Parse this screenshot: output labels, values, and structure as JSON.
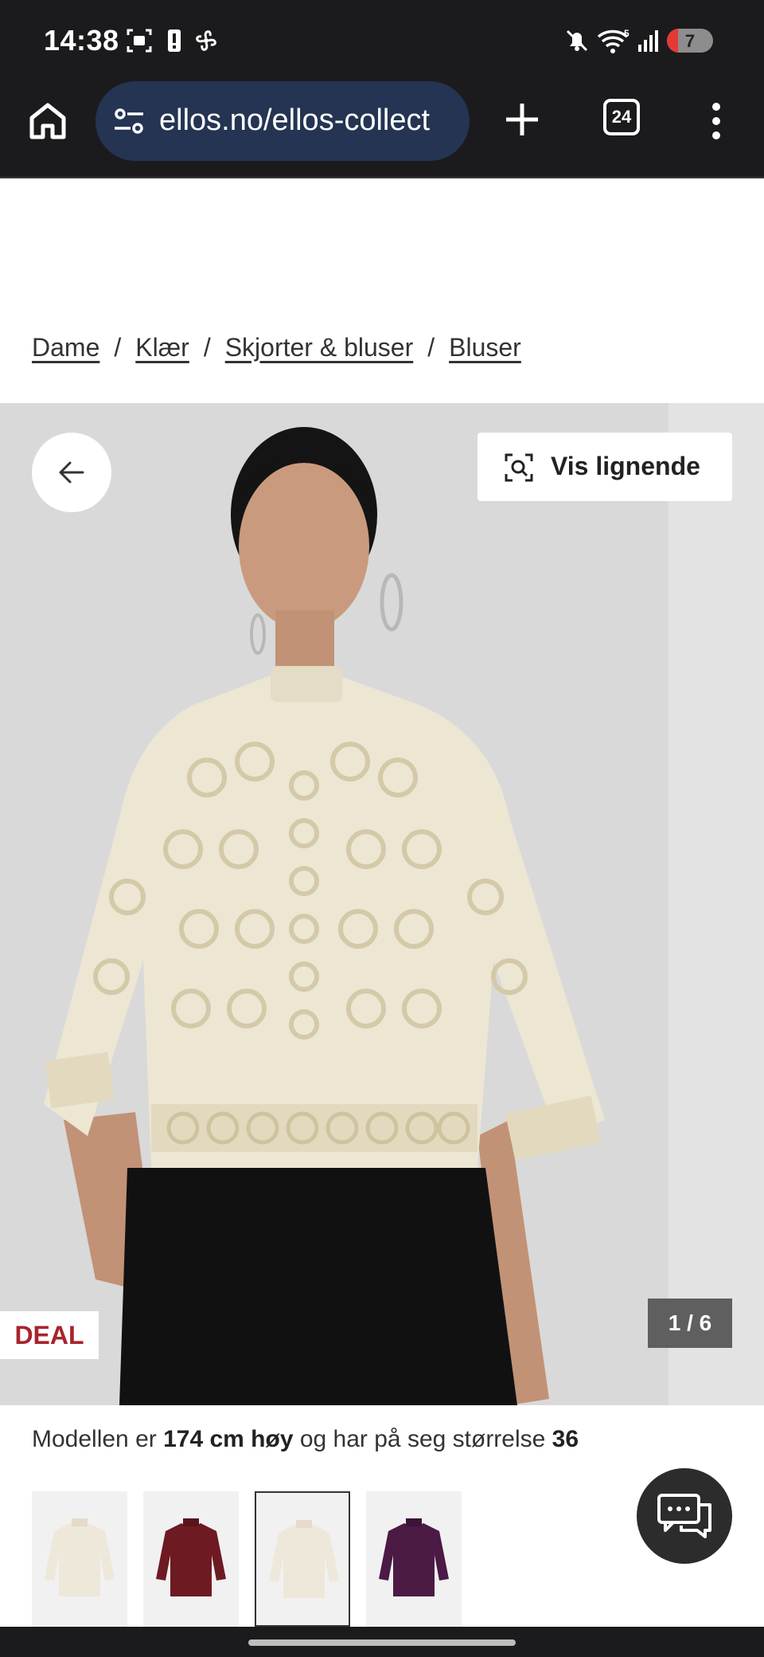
{
  "status": {
    "time": "14:38",
    "battery_level": "7"
  },
  "browser": {
    "url": "ellos.no/ellos-collect",
    "tab_count": "24"
  },
  "breadcrumb": {
    "items": [
      "Dame",
      "Klær",
      "Skjorter & bluser",
      "Bluser"
    ],
    "separator": "/"
  },
  "gallery": {
    "similar_button_label": "Vis lignende",
    "deal_badge": "DEAL",
    "counter": "1 / 6",
    "colors": {
      "deal": "#a8242d",
      "background": "#d9d9d9"
    }
  },
  "model_info": {
    "prefix": "Modellen er ",
    "height": "174 cm høy",
    "middle": " og har på seg størrelse ",
    "size": "36"
  },
  "thumbnails": {
    "items": [
      {
        "name": "cream-lace-blouse",
        "color": "#ede8da"
      },
      {
        "name": "burgundy-lace-blouse",
        "color": "#6e1a22"
      },
      {
        "name": "cream-lace-blouse-selected",
        "color": "#ede8da"
      },
      {
        "name": "purple-lace-blouse",
        "color": "#4b1a45"
      }
    ],
    "selected_index": 2
  }
}
